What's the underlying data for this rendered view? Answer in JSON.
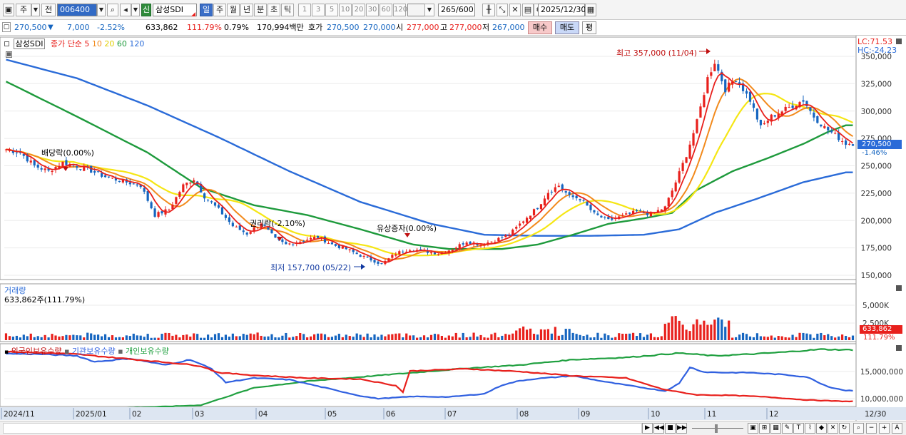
{
  "toolbar": {
    "period_type": "주",
    "prev_label": "전",
    "code": "006400",
    "credit_badge": "신",
    "stock_name": "삼성SDI",
    "periods": [
      "일",
      "주",
      "월",
      "년",
      "분",
      "초",
      "틱"
    ],
    "intervals": [
      "1",
      "3",
      "5",
      "10",
      "20",
      "30",
      "60",
      "120"
    ],
    "count_value": "265",
    "count_total": "/600",
    "date": "2025/12/30"
  },
  "quote": {
    "price": "270,500",
    "change": "7,000",
    "change_pct": "-2.52%",
    "volume": "633,862",
    "volume_ratio": "111.79%",
    "turnover_ratio": "0.79%",
    "amount": "170,994백만",
    "hoga_label": "호가",
    "ask": "270,500",
    "bid": "270,000",
    "open_label": "시",
    "open": "277,000",
    "high_label": "고",
    "high": "277,000",
    "low_label": "저",
    "low": "267,000",
    "buy_label": "매수",
    "sell_label": "매도",
    "eval_label": "평"
  },
  "legend": {
    "name": "삼성SDI",
    "price_label": "종가 단순",
    "ma_periods": [
      "5",
      "10",
      "20",
      "60",
      "120"
    ],
    "lc": "LC:71.53",
    "hc": "HC:-24.23"
  },
  "annotations": {
    "dividend": "배당락(0.00%)",
    "rights": "권리락(-2.10%)",
    "capital_increase": "유상증자(0.00%)",
    "high": "최고 357,000 (11/04)",
    "low": "최저 157,700 (05/22)"
  },
  "price_tag": {
    "value": "270,500",
    "pct": "-1.46%"
  },
  "volume_panel": {
    "title": "거래량",
    "summary": "633,862주(111.79%)",
    "tag": "633,862",
    "tag_pct": "111.79%"
  },
  "holdings_panel": {
    "labels": [
      "외국인보유수량",
      "기관보유수량",
      "개인보유수량"
    ]
  },
  "x_labels": [
    "2024/11",
    "2025/01",
    "02",
    "03",
    "04",
    "05",
    "06",
    "07",
    "08",
    "09",
    "10",
    "11",
    "12"
  ],
  "x_end_label": "12/30",
  "colors": {
    "up": "#e8201c",
    "down": "#1565c0",
    "ma5": "#e8201c",
    "ma10": "#f28a1c",
    "ma20": "#f5e614",
    "ma60": "#1e9a3c",
    "ma120": "#2a6bd8",
    "foreign": "#e8201c",
    "institution": "#3060e0",
    "individual": "#20a040"
  },
  "chart_data": {
    "type": "candlestick",
    "y_ticks": [
      150000,
      175000,
      200000,
      225000,
      250000,
      275000,
      300000,
      325000,
      350000
    ],
    "ylim": [
      145000,
      365000
    ],
    "volume_ticks": [
      "5,000K",
      "2,500K"
    ],
    "volume_ylim": [
      0,
      7000
    ],
    "holding_ticks": [
      "15,000,000",
      "10,000,000"
    ],
    "holding_ylim": [
      7500000,
      20000000
    ],
    "anchors": [
      [
        0,
        265000
      ],
      [
        4,
        262000
      ],
      [
        8,
        250000
      ],
      [
        12,
        245000
      ],
      [
        16,
        253000
      ],
      [
        22,
        248000
      ],
      [
        28,
        240000
      ],
      [
        34,
        235000
      ],
      [
        38,
        232000
      ],
      [
        42,
        205000
      ],
      [
        46,
        210000
      ],
      [
        50,
        232000
      ],
      [
        53,
        238000
      ],
      [
        56,
        222000
      ],
      [
        60,
        210000
      ],
      [
        64,
        195000
      ],
      [
        68,
        188000
      ],
      [
        72,
        198000
      ],
      [
        76,
        183000
      ],
      [
        79,
        178000
      ],
      [
        84,
        182000
      ],
      [
        88,
        185000
      ],
      [
        92,
        178000
      ],
      [
        96,
        174000
      ],
      [
        100,
        168000
      ],
      [
        104,
        163000
      ],
      [
        106,
        160000
      ],
      [
        110,
        170000
      ],
      [
        114,
        174000
      ],
      [
        118,
        172000
      ],
      [
        122,
        170000
      ],
      [
        126,
        174000
      ],
      [
        130,
        181000
      ],
      [
        134,
        178000
      ],
      [
        138,
        182000
      ],
      [
        142,
        187000
      ],
      [
        146,
        200000
      ],
      [
        150,
        212000
      ],
      [
        153,
        226000
      ],
      [
        156,
        232000
      ],
      [
        159,
        222000
      ],
      [
        162,
        220000
      ],
      [
        166,
        206000
      ],
      [
        170,
        200000
      ],
      [
        174,
        204000
      ],
      [
        178,
        208000
      ],
      [
        182,
        206000
      ],
      [
        186,
        212000
      ],
      [
        189,
        235000
      ],
      [
        192,
        260000
      ],
      [
        195,
        290000
      ],
      [
        198,
        330000
      ],
      [
        200,
        345000
      ],
      [
        203,
        320000
      ],
      [
        206,
        330000
      ],
      [
        210,
        310000
      ],
      [
        213,
        285000
      ],
      [
        216,
        295000
      ],
      [
        219,
        300000
      ],
      [
        222,
        305000
      ],
      [
        225,
        310000
      ],
      [
        228,
        295000
      ],
      [
        231,
        285000
      ],
      [
        234,
        278000
      ],
      [
        237,
        270500
      ]
    ],
    "ma60": [
      [
        0,
        327000
      ],
      [
        20,
        295000
      ],
      [
        40,
        262000
      ],
      [
        55,
        230000
      ],
      [
        70,
        214000
      ],
      [
        85,
        205000
      ],
      [
        100,
        192000
      ],
      [
        115,
        178000
      ],
      [
        125,
        174000
      ],
      [
        140,
        174000
      ],
      [
        150,
        178000
      ],
      [
        160,
        187000
      ],
      [
        170,
        197000
      ],
      [
        180,
        202000
      ],
      [
        188,
        207000
      ],
      [
        195,
        228000
      ],
      [
        205,
        245000
      ],
      [
        215,
        257000
      ],
      [
        225,
        270000
      ],
      [
        232,
        281000
      ],
      [
        237,
        287000
      ]
    ],
    "ma120": [
      [
        0,
        347000
      ],
      [
        20,
        330000
      ],
      [
        40,
        305000
      ],
      [
        60,
        276000
      ],
      [
        80,
        245000
      ],
      [
        100,
        217000
      ],
      [
        120,
        197000
      ],
      [
        135,
        187000
      ],
      [
        150,
        186000
      ],
      [
        165,
        186000
      ],
      [
        180,
        187000
      ],
      [
        190,
        192000
      ],
      [
        200,
        207000
      ],
      [
        212,
        220000
      ],
      [
        225,
        235000
      ],
      [
        237,
        244000
      ]
    ],
    "foreign": [
      [
        0,
        18700000
      ],
      [
        20,
        18200000
      ],
      [
        30,
        17600000
      ],
      [
        40,
        17000000
      ],
      [
        50,
        16400000
      ],
      [
        55,
        16000000
      ],
      [
        60,
        14800000
      ],
      [
        70,
        14300000
      ],
      [
        85,
        13800000
      ],
      [
        100,
        13600000
      ],
      [
        110,
        12400000
      ],
      [
        112,
        11200000
      ],
      [
        114,
        15100000
      ],
      [
        130,
        15500000
      ],
      [
        145,
        15000000
      ],
      [
        160,
        14200000
      ],
      [
        175,
        13800000
      ],
      [
        185,
        11800000
      ],
      [
        190,
        11200000
      ],
      [
        195,
        10700000
      ],
      [
        205,
        10600000
      ],
      [
        215,
        10300000
      ],
      [
        225,
        9800000
      ],
      [
        232,
        9600000
      ],
      [
        237,
        9500000
      ]
    ],
    "institution": [
      [
        0,
        18300000
      ],
      [
        10,
        18200000
      ],
      [
        20,
        17900000
      ],
      [
        25,
        16800000
      ],
      [
        35,
        17400000
      ],
      [
        45,
        16200000
      ],
      [
        52,
        17200000
      ],
      [
        58,
        15500000
      ],
      [
        62,
        13000000
      ],
      [
        70,
        13800000
      ],
      [
        80,
        13500000
      ],
      [
        90,
        12000000
      ],
      [
        100,
        10500000
      ],
      [
        105,
        10000000
      ],
      [
        115,
        10400000
      ],
      [
        125,
        10300000
      ],
      [
        135,
        10900000
      ],
      [
        140,
        12500000
      ],
      [
        145,
        13300000
      ],
      [
        150,
        13700000
      ],
      [
        160,
        14200000
      ],
      [
        170,
        13000000
      ],
      [
        180,
        12000000
      ],
      [
        186,
        11400000
      ],
      [
        190,
        12800000
      ],
      [
        193,
        15800000
      ],
      [
        197,
        14900000
      ],
      [
        203,
        14800000
      ],
      [
        210,
        14800000
      ],
      [
        220,
        14400000
      ],
      [
        226,
        14000000
      ],
      [
        232,
        12200000
      ],
      [
        237,
        11500000
      ]
    ],
    "individual": [
      [
        0,
        7800000
      ],
      [
        20,
        8000000
      ],
      [
        40,
        8400000
      ],
      [
        55,
        8800000
      ],
      [
        70,
        12000000
      ],
      [
        85,
        13200000
      ],
      [
        100,
        14000000
      ],
      [
        115,
        14800000
      ],
      [
        130,
        15600000
      ],
      [
        145,
        16200000
      ],
      [
        160,
        17200000
      ],
      [
        175,
        17600000
      ],
      [
        190,
        18400000
      ],
      [
        200,
        17900000
      ],
      [
        210,
        18200000
      ],
      [
        220,
        18600000
      ],
      [
        230,
        19100000
      ],
      [
        237,
        19000000
      ]
    ]
  }
}
